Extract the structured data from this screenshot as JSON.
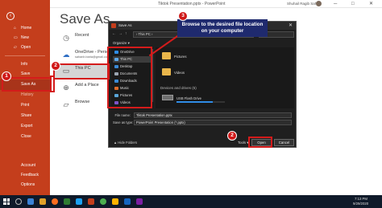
{
  "titlebar": {
    "document": "Tiktok Presentation.pptx  -  PowerPoint",
    "user": "Shuhail Ragib Sahan"
  },
  "rail": {
    "back_icon": "back-arrow-icon",
    "items": [
      {
        "label": "Home",
        "icon": "home-icon"
      },
      {
        "label": "New",
        "icon": "new-doc-icon"
      },
      {
        "label": "Open",
        "icon": "open-folder-icon"
      },
      {
        "label": "Info"
      },
      {
        "label": "Save"
      },
      {
        "label": "Save As"
      },
      {
        "label": "History"
      },
      {
        "label": "Print"
      },
      {
        "label": "Share"
      },
      {
        "label": "Export"
      },
      {
        "label": "Close"
      },
      {
        "label": "Account"
      },
      {
        "label": "Feedback"
      },
      {
        "label": "Options"
      }
    ]
  },
  "backstage": {
    "title": "Save As",
    "locations": [
      {
        "label": "Recent",
        "sub": "",
        "icon": "clock-icon"
      },
      {
        "label": "OneDrive - Personal",
        "sub": "sahanb.baria@gmail.com",
        "icon": "onedrive-cloud-icon"
      },
      {
        "label": "This PC",
        "sub": "",
        "icon": "computer-icon"
      },
      {
        "label": "Add a Place",
        "sub": "",
        "icon": "globe-icon"
      },
      {
        "label": "Browse",
        "sub": "",
        "icon": "folder-icon"
      }
    ],
    "bg_folders": [
      "folder",
      "folder"
    ]
  },
  "dialog": {
    "caption": "Save As",
    "address": "›  This PC  ›",
    "organize": "Organize ▾",
    "nav_items": [
      {
        "label": "OneDrive",
        "color": "#2f8ce6"
      },
      {
        "label": "This PC",
        "color": "#5fa8e8"
      },
      {
        "label": "Desktop",
        "color": "#3a8ad6"
      },
      {
        "label": "Documents",
        "color": "#9aa5b1"
      },
      {
        "label": "Downloads",
        "color": "#3a8ad6"
      },
      {
        "label": "Music",
        "color": "#e06c2a"
      },
      {
        "label": "Pictures",
        "color": "#59a6d9"
      },
      {
        "label": "Videos",
        "color": "#7c55c9"
      }
    ],
    "folders": [
      "Pictures",
      "Videos"
    ],
    "devices_header": "Devices and drives (5)",
    "drive": {
      "label": "USB Flash Drive",
      "used_fraction": 0.75
    },
    "file_name_label": "File name:",
    "file_name_value": "Tiktok Presentation.pptx",
    "save_type_label": "Save as type:",
    "save_type_value": "PowerPoint Presentation (*.pptx)",
    "hide_folders": "▲  Hide Folders",
    "tools": "Tools  ▾",
    "open_label": "Open",
    "cancel_label": "Cancel"
  },
  "callouts": {
    "main": "Browse to the desired file location on your computer",
    "badges": [
      "1",
      "2",
      "3",
      "2"
    ]
  },
  "colors": {
    "rail": "#c43e1c",
    "callout": "#1f2a6e",
    "highlight": "#d41b1b",
    "taskbar": "#0f1a2a"
  },
  "taskbar": {
    "time": "7:13 PM",
    "date": "9/29/2020"
  }
}
